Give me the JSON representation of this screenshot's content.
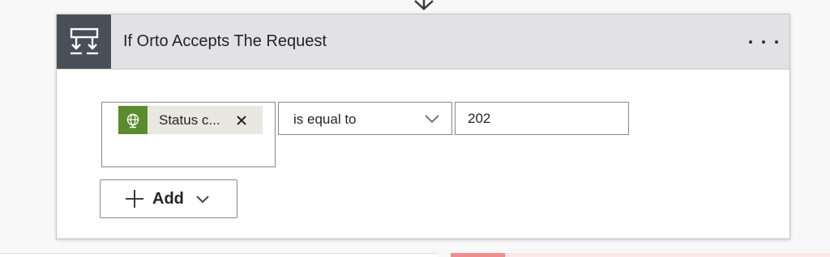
{
  "step": {
    "title": "If Orto Accepts The Request",
    "icon": "condition-icon",
    "more_menu": "ellipsis-icon",
    "header_color": "#e2e1e6",
    "icon_bg_color": "#484f58"
  },
  "condition": {
    "token": {
      "label": "Status c...",
      "icon": "globe-icon",
      "remove_icon": "close-icon",
      "color": "#5b8b2e"
    },
    "operator": {
      "selected": "is equal to",
      "icon": "chevron-down-icon"
    },
    "value": "202"
  },
  "add_button": {
    "label": "Add",
    "icon": "plus-icon",
    "dropdown_icon": "chevron-down-icon"
  }
}
